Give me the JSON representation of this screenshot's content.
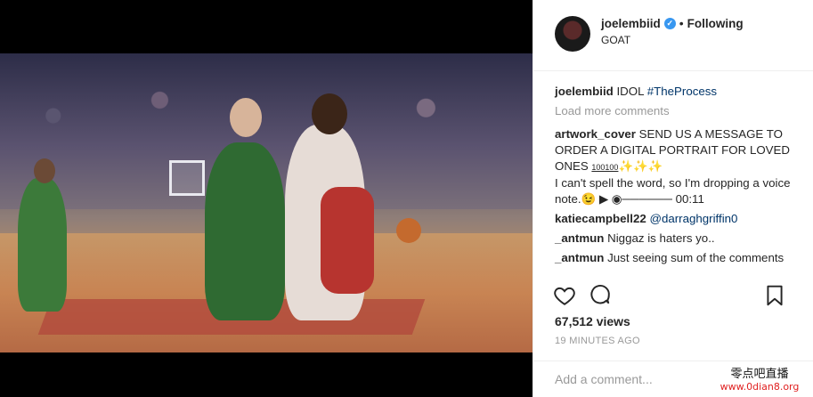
{
  "post": {
    "username": "joelembiid",
    "following_label": "Following",
    "location": "GOAT",
    "caption_user": "joelembiid",
    "caption_text": "IDOL",
    "caption_tag": "#TheProcess",
    "load_more": "Load more comments",
    "comments": [
      {
        "user": "artwork_cover",
        "text": "SEND US A MESSAGE TO ORDER A DIGITAL PORTRAIT FOR LOVED ONES",
        "suffix": "100100",
        "emoji": "✨✨✨"
      },
      {
        "user": "",
        "text": "I can't spell the word, so I'm dropping a voice note.😉 ▶ ◉────── 00:11"
      },
      {
        "user": "katiecampbell22",
        "text": "@darraghgriffin0"
      },
      {
        "user": "_antmun",
        "text": "Niggaz is haters yo.."
      },
      {
        "user": "_antmun",
        "text": "Just seeing sum of the comments"
      }
    ],
    "views": "67,512 views",
    "time": "19 MINUTES AGO",
    "add_comment_placeholder": "Add a comment..."
  },
  "watermark": {
    "line1": "零点吧直播",
    "line2": "www.0dian8.org"
  },
  "icons": [
    "heart-icon",
    "comment-icon",
    "bookmark-icon",
    "verified-icon"
  ],
  "colors": {
    "verified": "#3897f0",
    "hashtag": "#003569",
    "muted": "#999999"
  }
}
